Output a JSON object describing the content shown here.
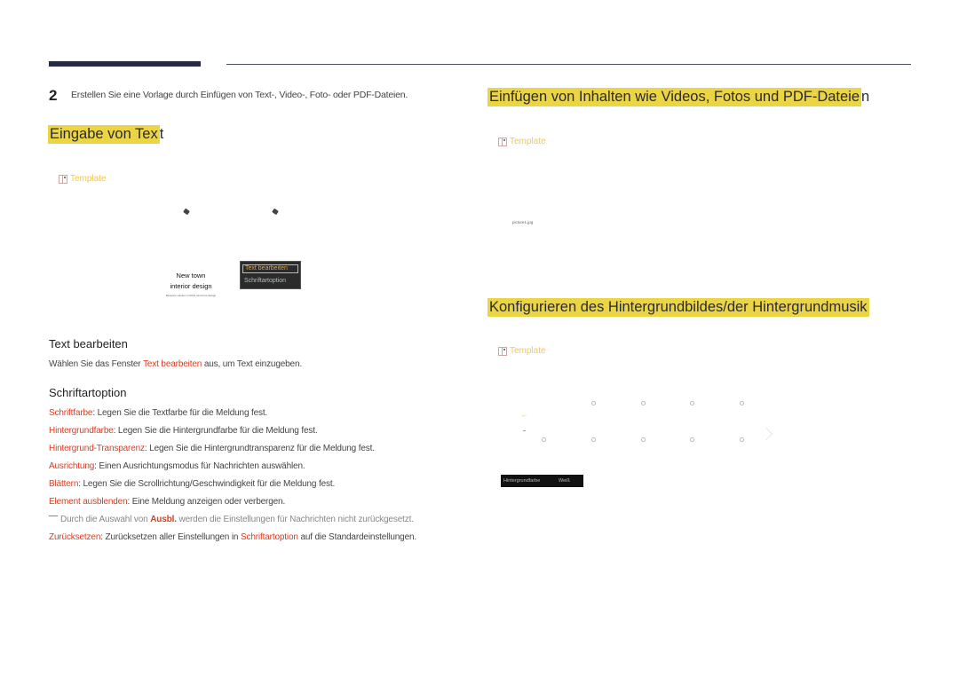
{
  "header": {
    "decor": "page-rule"
  },
  "left": {
    "step_number": "2",
    "step_text": "Erstellen Sie eine Vorlage durch Einfügen von Text-, Video-, Foto- oder PDF-Dateien.",
    "section_title_main": "Eingabe von Tex",
    "section_title_tail": "t",
    "template_label": "Template",
    "preview": {
      "line1": "New town",
      "line2": "interior design",
      "caption": "Bespoke solution unfolds tomorrow design"
    },
    "context_menu": {
      "items": [
        "Text bearbeiten",
        "Schriftartoption"
      ],
      "selected": "Text bearbeiten"
    },
    "text_edit": {
      "heading": "Text bearbeiten",
      "desc_pre": "Wählen Sie das Fenster ",
      "desc_link": "Text bearbeiten",
      "desc_post": " aus, um Text einzugeben."
    },
    "font_option": {
      "heading": "Schriftartoption",
      "items": [
        {
          "term": "Schriftfarbe",
          "desc": ": Legen Sie die Textfarbe für die Meldung fest."
        },
        {
          "term": "Hintergrundfarbe",
          "desc": ": Legen Sie die Hintergrundfarbe für die Meldung fest."
        },
        {
          "term": "Hintergrund-Transparenz",
          "desc": ": Legen Sie die Hintergrundtransparenz für die Meldung fest."
        },
        {
          "term": "Ausrichtung",
          "desc": ": Einen Ausrichtungsmodus für Nachrichten auswählen."
        },
        {
          "term": "Blättern",
          "desc": ": Legen Sie die Scrollrichtung/Geschwindigkeit für die Meldung fest."
        },
        {
          "term": "Element ausblenden",
          "desc": ": Eine Meldung anzeigen oder verbergen."
        }
      ],
      "note_pre": "Durch die Auswahl von ",
      "note_term": "Ausbl.",
      "note_post": " werden die Einstellungen für Nachrichten nicht zurückgesetzt.",
      "reset_term": "Zurücksetzen",
      "reset_pre": ": Zurücksetzen aller Einstellungen in ",
      "reset_link": "Schriftartoption",
      "reset_post": " auf die Standardeinstellungen."
    }
  },
  "right": {
    "section1": {
      "title_main": "Einfügen von Inhalten wie Videos, Fotos und PDF-Dateie",
      "title_tail": "n",
      "template_label": "Template",
      "file_label": "picture1.jpg"
    },
    "section2": {
      "title": "Konfigurieren des Hintergrundbildes/der Hintergrundmusik",
      "template_label": "Template",
      "bg_setting": {
        "key": "Hintergrundfarbe",
        "value": "Weiß"
      }
    }
  },
  "colors": {
    "highlight": "#ecd545",
    "term_red": "#e0391d",
    "template_yellow": "#f6c64b",
    "rule_navy": "#252a48"
  }
}
